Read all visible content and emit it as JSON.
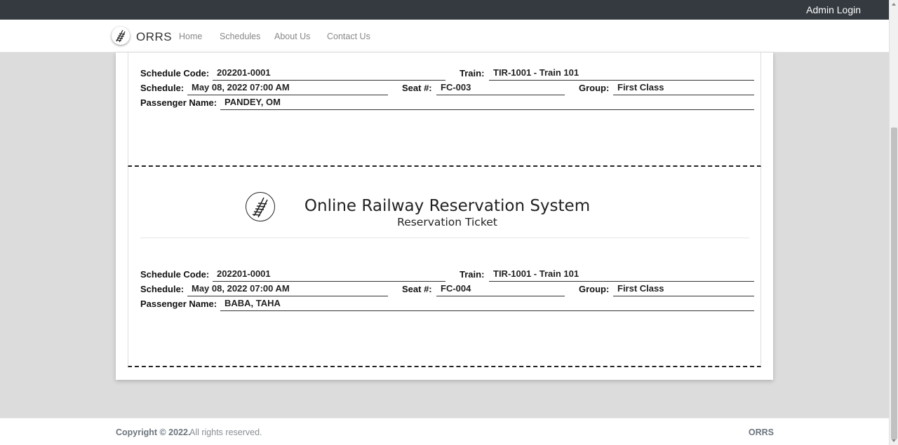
{
  "topbar": {
    "admin_login": "Admin Login"
  },
  "navbar": {
    "brand": "ORRS",
    "links": [
      "Home",
      "Schedules",
      "About Us",
      "Contact Us"
    ]
  },
  "labels": {
    "schedule_code": "Schedule Code:",
    "train": "Train:",
    "schedule": "Schedule:",
    "seat": "Seat #:",
    "group": "Group:",
    "passenger_name": "Passenger Name:"
  },
  "tickets": [
    {
      "schedule_code": "202201-0001",
      "train": "TIR-1001 - Train 101",
      "schedule": "May 08, 2022 07:00 AM",
      "seat": "FC-003",
      "group": "First Class",
      "passenger_name": "PANDEY, OM"
    },
    {
      "title": "Online Railway Reservation System",
      "subtitle": "Reservation Ticket",
      "schedule_code": "202201-0001",
      "train": "TIR-1001 - Train 101",
      "schedule": "May 08, 2022 07:00 AM",
      "seat": "FC-004",
      "group": "First Class",
      "passenger_name": "BABA, TAHA"
    }
  ],
  "footer": {
    "copyright_bold": "Copyright © 2022.",
    "copyright_rest": "All rights reserved.",
    "brand": "ORRS"
  },
  "icons": {
    "logo": "railway-track-icon"
  }
}
